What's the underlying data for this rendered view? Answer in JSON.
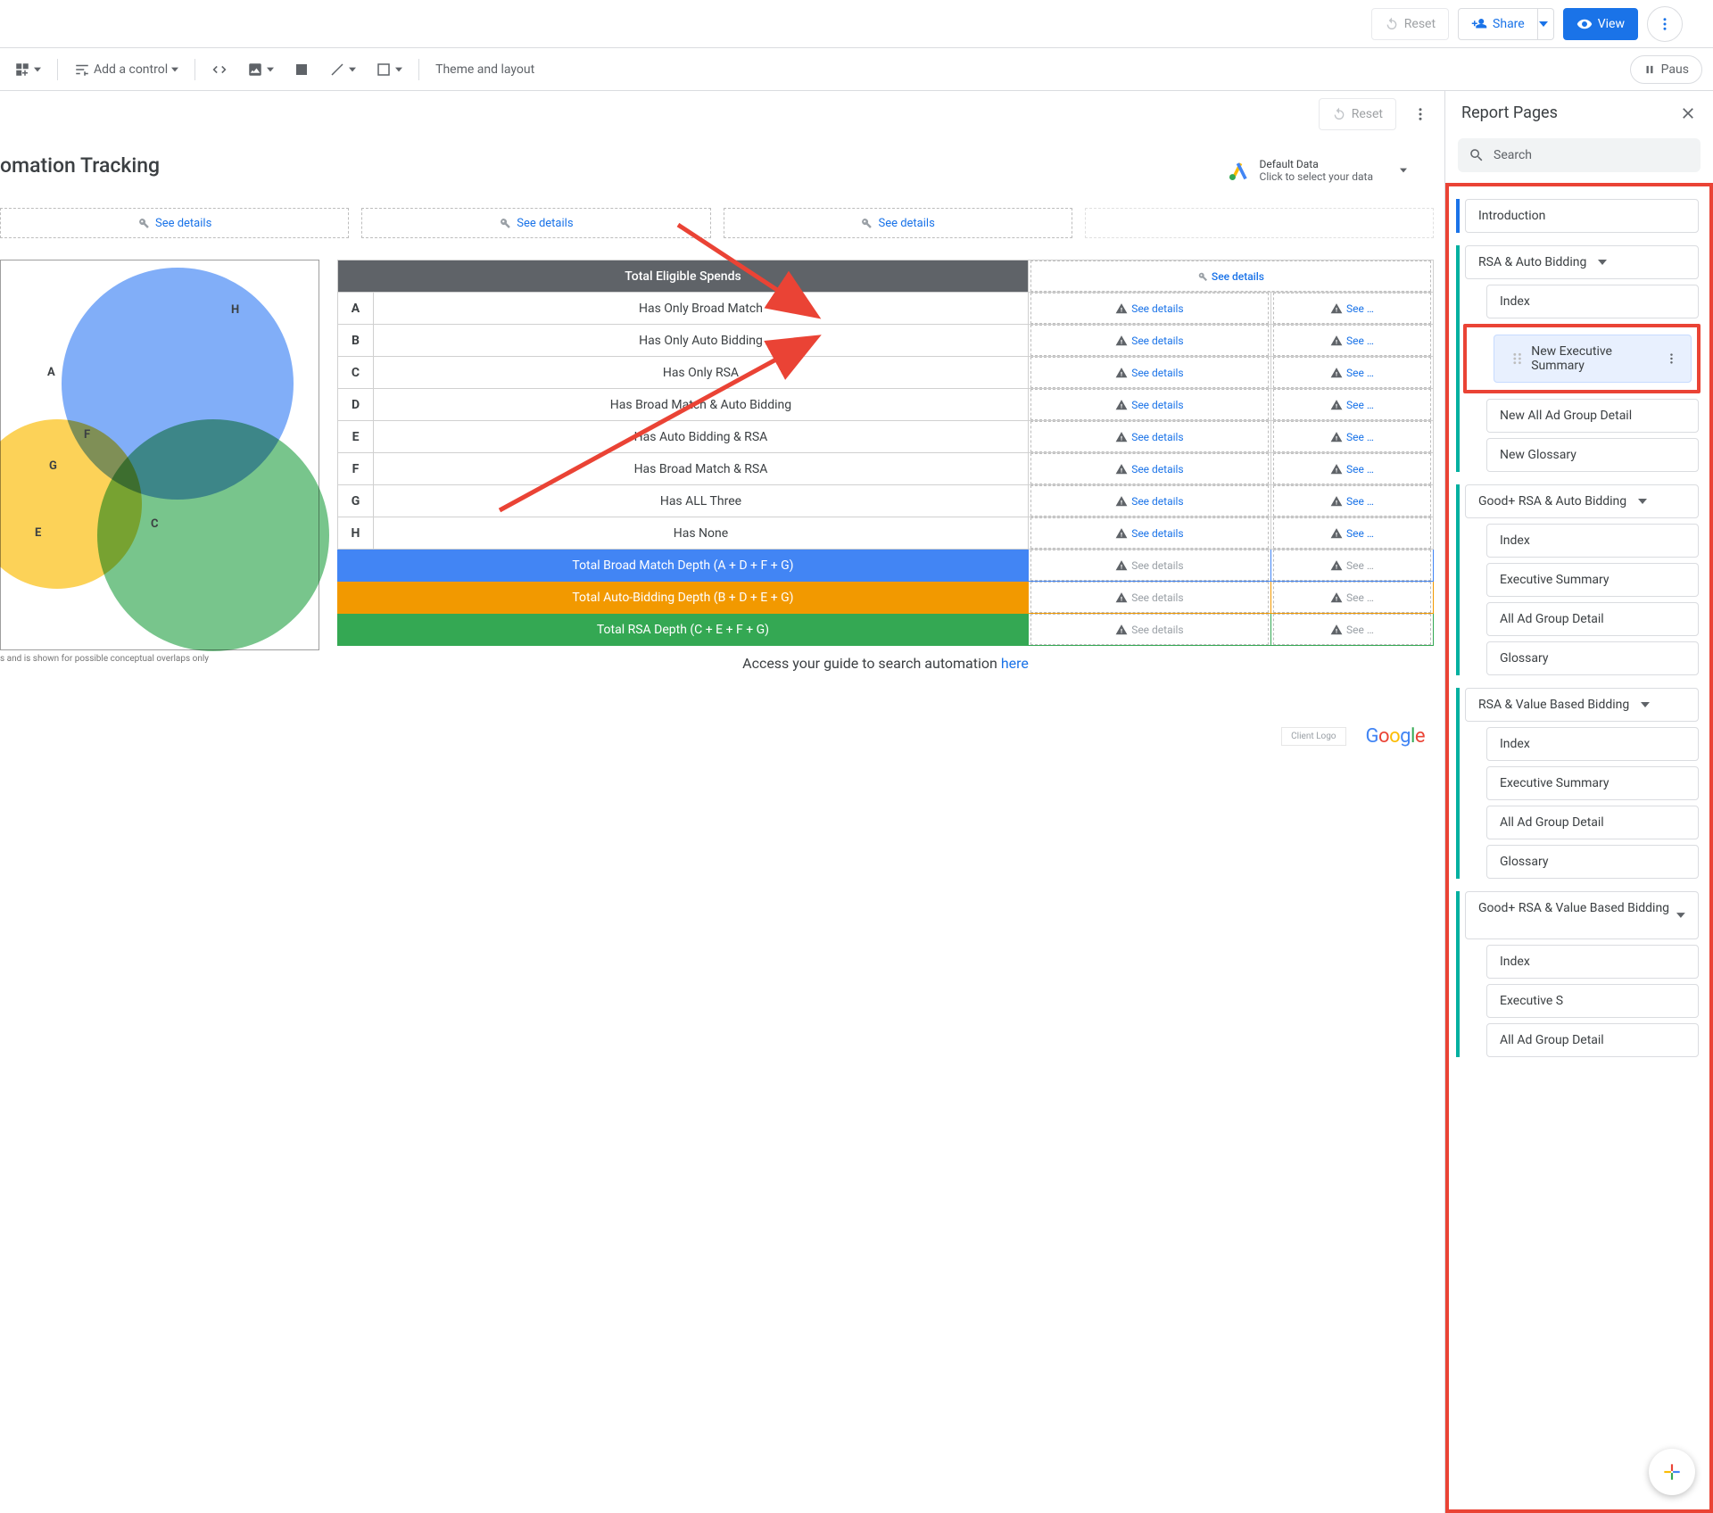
{
  "topbar": {
    "reset": "Reset",
    "share": "Share",
    "view": "View"
  },
  "toolbar": {
    "add_control": "Add a control",
    "theme": "Theme and layout",
    "pause": "Paus"
  },
  "inner": {
    "reset": "Reset"
  },
  "panel": {
    "title": "Report Pages",
    "search": "Search"
  },
  "report": {
    "heading": "omation Tracking",
    "data_source_1": "Default Data",
    "data_source_2": "Click to select your data",
    "see_details": "See details",
    "table_title": "Total Eligible Spends",
    "guide_1": "Access your guide to search automation ",
    "guide_2": "here",
    "caption": "s and is shown for possible conceptual overlaps only",
    "rows": [
      {
        "k": "A",
        "t": "Has Only Broad Match"
      },
      {
        "k": "B",
        "t": "Has Only Auto Bidding"
      },
      {
        "k": "C",
        "t": "Has Only RSA"
      },
      {
        "k": "D",
        "t": "Has Broad Match & Auto Bidding"
      },
      {
        "k": "E",
        "t": "Has Auto Bidding & RSA"
      },
      {
        "k": "F",
        "t": "Has Broad Match & RSA"
      },
      {
        "k": "G",
        "t": "Has ALL Three"
      },
      {
        "k": "H",
        "t": "Has None"
      }
    ],
    "total_blue": "Total Broad Match Depth (A + D + F + G)",
    "total_orange": "Total Auto-Bidding Depth (B + D + E + G)",
    "total_green": "Total RSA Depth (C + E + F + G)",
    "client_logo": "Client Logo"
  },
  "pages": {
    "intro": "Introduction",
    "g1": "RSA & Auto Bidding",
    "g1_items": [
      "Index",
      "New Executive Summary",
      "New All Ad Group Detail",
      "New Glossary"
    ],
    "g2": "Good+ RSA & Auto Bidding",
    "g2_items": [
      "Index",
      "Executive Summary",
      "All Ad Group Detail",
      "Glossary"
    ],
    "g3": "RSA & Value Based Bidding",
    "g3_items": [
      "Index",
      "Executive Summary",
      "All Ad Group Detail",
      "Glossary"
    ],
    "g4": "Good+ RSA & Value Based Bidding",
    "g4_items": [
      "Index",
      "Executive S",
      "All Ad Group Detail"
    ]
  },
  "vlabels": {
    "A": "A",
    "H": "H",
    "F": "F",
    "G": "G",
    "E": "E",
    "C": "C"
  }
}
